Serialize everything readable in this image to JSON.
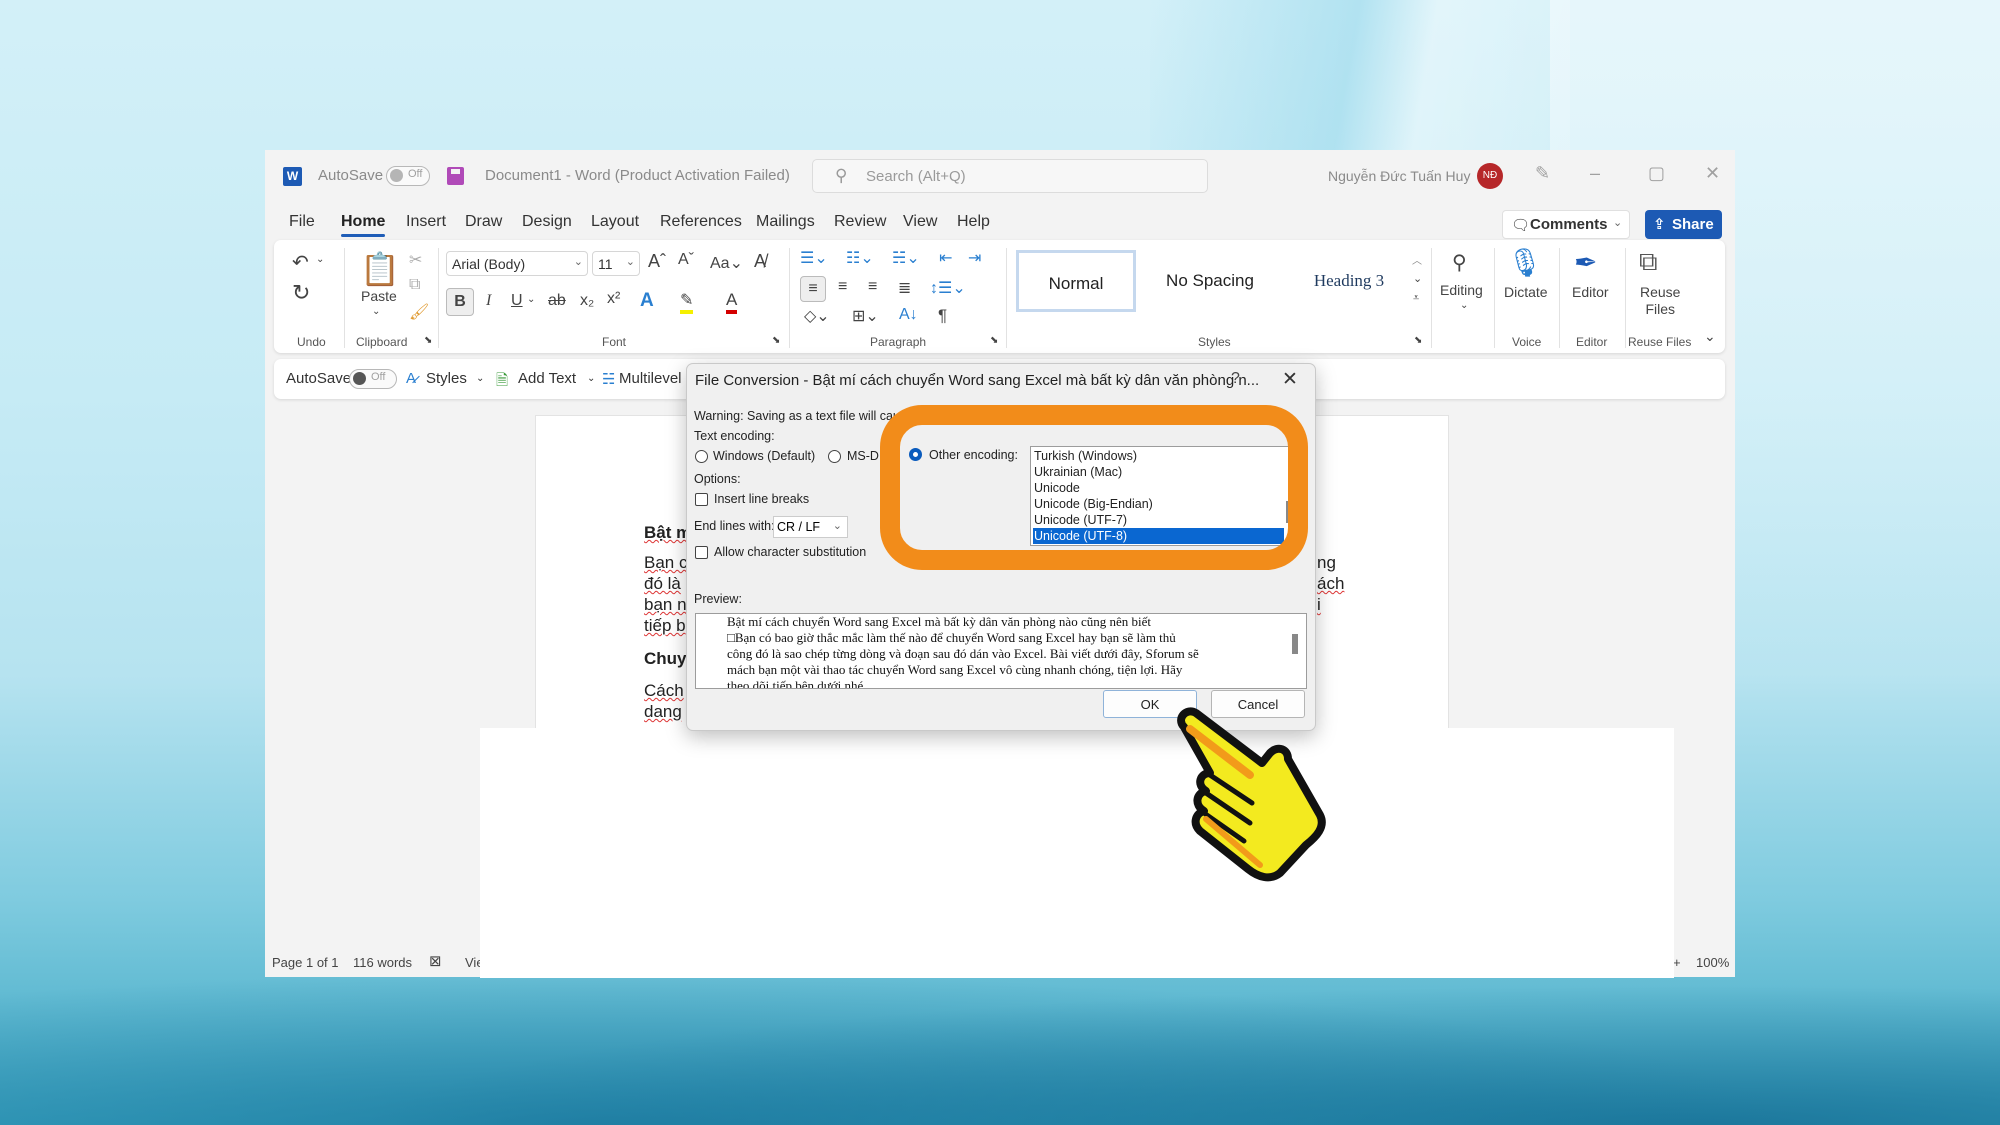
{
  "titlebar": {
    "app_icon": "word-icon",
    "autosave_label": "AutoSave",
    "autosave_state": "Off",
    "document_title": "Document1  -  Word (Product Activation Failed)",
    "search_placeholder": "Search (Alt+Q)",
    "user_name": "Nguyễn Đức Tuấn Huy",
    "user_initials": "NĐ",
    "minimize": "–",
    "restore": "▢",
    "close": "✕"
  },
  "menu": {
    "tabs": [
      "File",
      "Home",
      "Insert",
      "Draw",
      "Design",
      "Layout",
      "References",
      "Mailings",
      "Review",
      "View",
      "Help"
    ],
    "active_tab": "Home",
    "comments_label": "Comments",
    "share_label": "Share"
  },
  "ribbon": {
    "groups": {
      "undo": "Undo",
      "clipboard": "Clipboard",
      "font": "Font",
      "paragraph": "Paragraph",
      "styles": "Styles",
      "voice": "Voice",
      "editor": "Editor",
      "reuse_files": "Reuse Files"
    },
    "paste_label": "Paste",
    "font_name": "Arial (Body)",
    "font_size": "11",
    "styles": [
      "Normal",
      "No Spacing",
      "Heading 3"
    ],
    "editing_label": "Editing",
    "dictate_label": "Dictate",
    "editor_label": "Editor",
    "reuse_files_label": "Reuse\nFiles",
    "colors": {
      "highlight": "#f5f000",
      "font_color": "#d40000",
      "accent": "#1d5ab4"
    }
  },
  "qat": {
    "autosave_label": "AutoSave",
    "autosave_state": "Off",
    "styles_label": "Styles",
    "add_text_label": "Add Text",
    "multilevel_label": "Multilevel Lis"
  },
  "document": {
    "heading1": "Bật m",
    "para1": [
      "Bạn c",
      "đó là",
      "bạn n",
      "tiếp b"
    ],
    "heading2": "Chuy",
    "para2": [
      "Cách",
      "dang"
    ],
    "right_frag": [
      "ng",
      "ách",
      "i"
    ]
  },
  "statusbar": {
    "page": "Page 1 of 1",
    "words": "116 words",
    "view": "Vie",
    "zoom_plus": "+",
    "zoom": "100%"
  },
  "dialog": {
    "title": "File Conversion - Bật mí cách chuyển Word sang Excel mà bất kỳ dân văn phòng n...",
    "help": "?",
    "close": "✕",
    "warning": "Warning: Saving as a text file will cau",
    "text_encoding_label": "Text encoding:",
    "enc_windows": "Windows (Default)",
    "enc_msdos": "MS-D",
    "enc_other": "Other encoding:",
    "selected_encoding": "other",
    "options_label": "Options:",
    "insert_line_breaks": "Insert line breaks",
    "insert_line_breaks_checked": false,
    "end_lines_label": "End lines with:",
    "end_lines_value": "CR / LF",
    "allow_substitution": "Allow character substitution",
    "allow_substitution_checked": false,
    "encodings": [
      "Turkish (Windows)",
      "Ukrainian (Mac)",
      "Unicode",
      "Unicode (Big-Endian)",
      "Unicode (UTF-7)",
      "Unicode (UTF-8)"
    ],
    "selected_index": 5,
    "preview_label": "Preview:",
    "preview_lines": [
      "Bật mí cách chuyển Word sang Excel mà bất kỳ dân văn phòng nào cũng nên biết",
      "□Bạn có bao giờ thắc mắc làm thế nào để chuyển Word sang Excel hay bạn sẽ làm thủ",
      "công đó là sao chép từng dòng và đoạn sau đó dán vào Excel. Bài viết dưới đây, Sforum sẽ",
      "mách bạn một vài thao tác chuyển Word sang Excel vô cùng nhanh chóng, tiện lợi. Hãy",
      "theo dõi tiếp bên dưới nhé"
    ],
    "ok_label": "OK",
    "cancel_label": "Cancel"
  },
  "annotations": {
    "highlight_color": "#f28c1a",
    "pointer": "pointing-hand-icon"
  }
}
